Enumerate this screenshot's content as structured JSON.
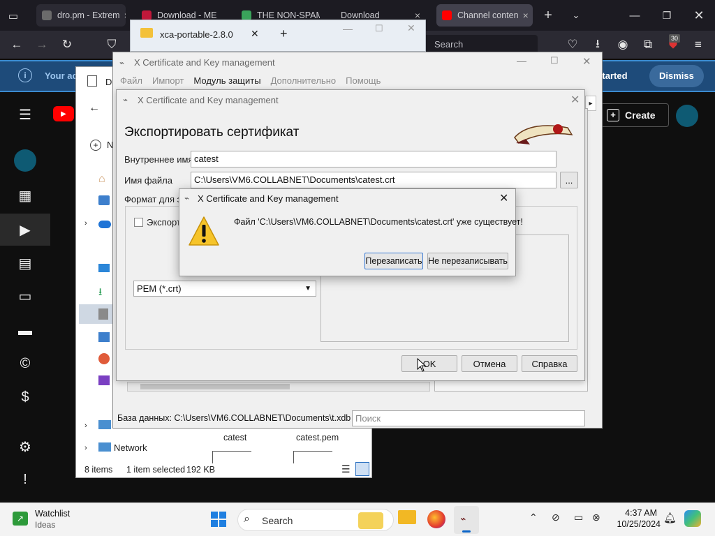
{
  "browser": {
    "tabs": [
      {
        "title": "dro.pm - Extrem",
        "favicon_color": "#6b6b6b"
      },
      {
        "title": "Download - ME",
        "favicon_color": "#c0183a"
      },
      {
        "title": "THE NON-SPAM",
        "favicon_color": "#3aa35b"
      },
      {
        "title": "Download",
        "favicon_color": "#444"
      },
      {
        "title": "Channel conten",
        "favicon_color": "#ff0000"
      }
    ],
    "url_placeholder": "Search",
    "extension_badge": "30",
    "notification": {
      "text": "Your ac",
      "get_started": "et started",
      "dismiss": "Dismiss"
    }
  },
  "youtube": {
    "create_label": "Create",
    "sidebar_icons": [
      "avatar-icon",
      "dashboard-icon",
      "content-icon",
      "analytics-icon",
      "comments-icon",
      "subtitles-icon",
      "copyright-icon",
      "earn-icon",
      "settings-icon",
      "feedback-icon"
    ]
  },
  "explorer": {
    "window_title": "xca-portable-2.8.0",
    "tab_label": "D",
    "new_label": "N",
    "network_label": "Network",
    "files": [
      {
        "name": "catest"
      },
      {
        "name": "catest.pem"
      }
    ],
    "status": {
      "items": "8 items",
      "selected": "1 item selected",
      "size": "192 KB"
    }
  },
  "xca_main": {
    "title": "X Certificate and Key management",
    "menu": [
      "Файл",
      "Импорт",
      "Модуль защиты",
      "Дополнительно",
      "Помощь"
    ],
    "database_label": "База данных: C:\\Users\\VM6.COLLABNET\\Documents\\t.xdb",
    "search_placeholder": "Поиск"
  },
  "export_dialog": {
    "title": "X Certificate and Key management",
    "heading": "Экспортировать сертификат",
    "internal_name_label": "Внутреннее имя",
    "internal_name_value": "catest",
    "filename_label": "Имя файла",
    "filename_value": "C:\\Users\\VM6.COLLABNET\\Documents\\catest.crt",
    "browse_label": "...",
    "format_label": "Формат для эк",
    "export_checkbox_label": "Экспорт",
    "format_value": "PEM (*.crt)",
    "buttons": {
      "ok": "OK",
      "cancel": "Отмена",
      "help": "Справка"
    }
  },
  "confirm_dialog": {
    "title": "X Certificate and Key management",
    "message": "Файл 'C:\\Users\\VM6.COLLABNET\\Documents\\catest.crt' уже существует!",
    "overwrite": "Перезаписать",
    "no_overwrite": "Не перезаписывать"
  },
  "taskbar": {
    "widget_title": "Watchlist",
    "widget_subtitle": "Ideas",
    "search_label": "Search",
    "time": "4:37 AM",
    "date": "10/25/2024"
  }
}
